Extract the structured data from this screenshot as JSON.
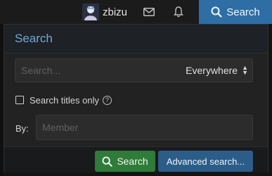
{
  "topbar": {
    "username": "zbizu",
    "search_button_label": "Search",
    "icons": [
      "avatar",
      "envelope-icon",
      "bell-icon",
      "search-icon"
    ]
  },
  "panel": {
    "title": "Search",
    "search_placeholder": "Search...",
    "scope_selected": "Everywhere",
    "titles_only_label": "Search titles only",
    "titles_only_checked": false,
    "by_label": "By:",
    "member_placeholder": "Member",
    "search_button_label": "Search",
    "advanced_button_label": "Advanced search..."
  },
  "colors": {
    "accent_blue": "#2f6ea5",
    "search_green": "#2f7b3a",
    "header_text": "#6fa7d8"
  }
}
